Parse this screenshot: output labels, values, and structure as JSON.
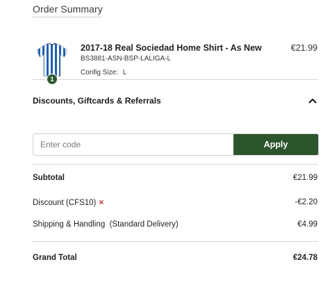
{
  "summary": {
    "title": "Order Summary"
  },
  "item": {
    "name": "2017-18 Real Sociedad Home Shirt - As New",
    "sku": "BS3881-ASN-BSP-LALIGA-L",
    "config_label": "Config Size:",
    "config_value": "L",
    "price": "€21.99",
    "quantity": "1",
    "image_icon": "football-shirt-thumbnail",
    "shirt_colors": {
      "blue": "#1f5fb0",
      "white": "#ffffff"
    }
  },
  "discounts": {
    "title": "Discounts, Giftcards & Referrals",
    "expanded": true,
    "input_placeholder": "Enter code",
    "input_value": "",
    "apply_label": "Apply"
  },
  "totals": {
    "subtotal_label": "Subtotal",
    "subtotal_value": "€21.99",
    "discount_label": "Discount (CFS10)",
    "discount_value": "-€2.20",
    "remove_symbol": "×",
    "shipping_label": "Shipping & Handling  (Standard Delivery)",
    "shipping_value": "€4.99",
    "grand_label": "Grand Total",
    "grand_value": "€24.78"
  },
  "colors": {
    "accent_green": "#2c542d",
    "remove_red": "#d22c2c",
    "divider": "#d6d6d6"
  }
}
